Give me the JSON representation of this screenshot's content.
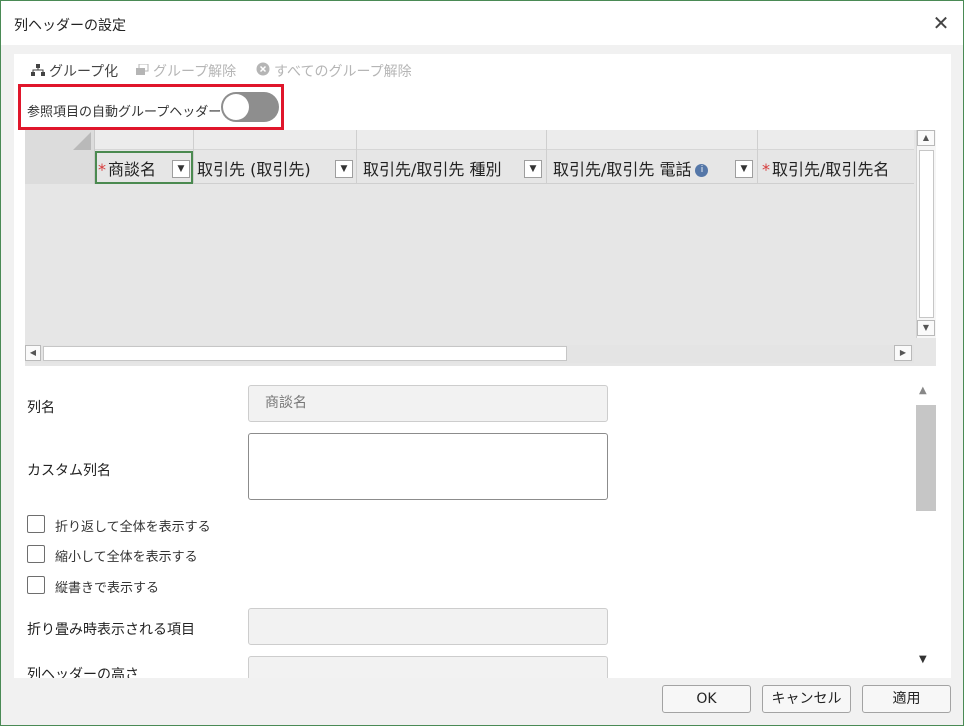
{
  "dialog": {
    "title": "列ヘッダーの設定",
    "close_glyph": "✕"
  },
  "toolbar": {
    "group_label": "グループ化",
    "ungroup_label": "グループ解除",
    "ungroup_all_label": "すべてのグループ解除"
  },
  "toggle": {
    "label": "参照項目の自動グループヘッダー",
    "state": "off"
  },
  "grid": {
    "required_mark": "*",
    "dropdown_glyph": "▼",
    "info_glyph": "i",
    "columns": [
      {
        "label": "商談名",
        "required": true,
        "selected": true
      },
      {
        "label": "取引先 (取引先)",
        "required": false
      },
      {
        "label": "取引先/取引先 種別",
        "required": false
      },
      {
        "label": "取引先/取引先 電話",
        "required": false,
        "info": true
      },
      {
        "label": "取引先/取引先名",
        "required": true
      }
    ],
    "scroll": {
      "up": "▲",
      "down": "▼",
      "left": "◀",
      "right": "▶"
    }
  },
  "form": {
    "column_name_label": "列名",
    "column_name_value": "商談名",
    "custom_name_label": "カスタム列名",
    "custom_name_value": "",
    "wrap_label": "折り返して全体を表示する",
    "shrink_label": "縮小して全体を表示する",
    "vertical_label": "縦書きで表示する",
    "collapsed_label": "折り畳み時表示される項目",
    "height_label": "列ヘッダーの高さ",
    "scroll_up": "▲",
    "scroll_down": "▼"
  },
  "footer": {
    "ok": "OK",
    "cancel": "キャンセル",
    "apply": "適用"
  }
}
